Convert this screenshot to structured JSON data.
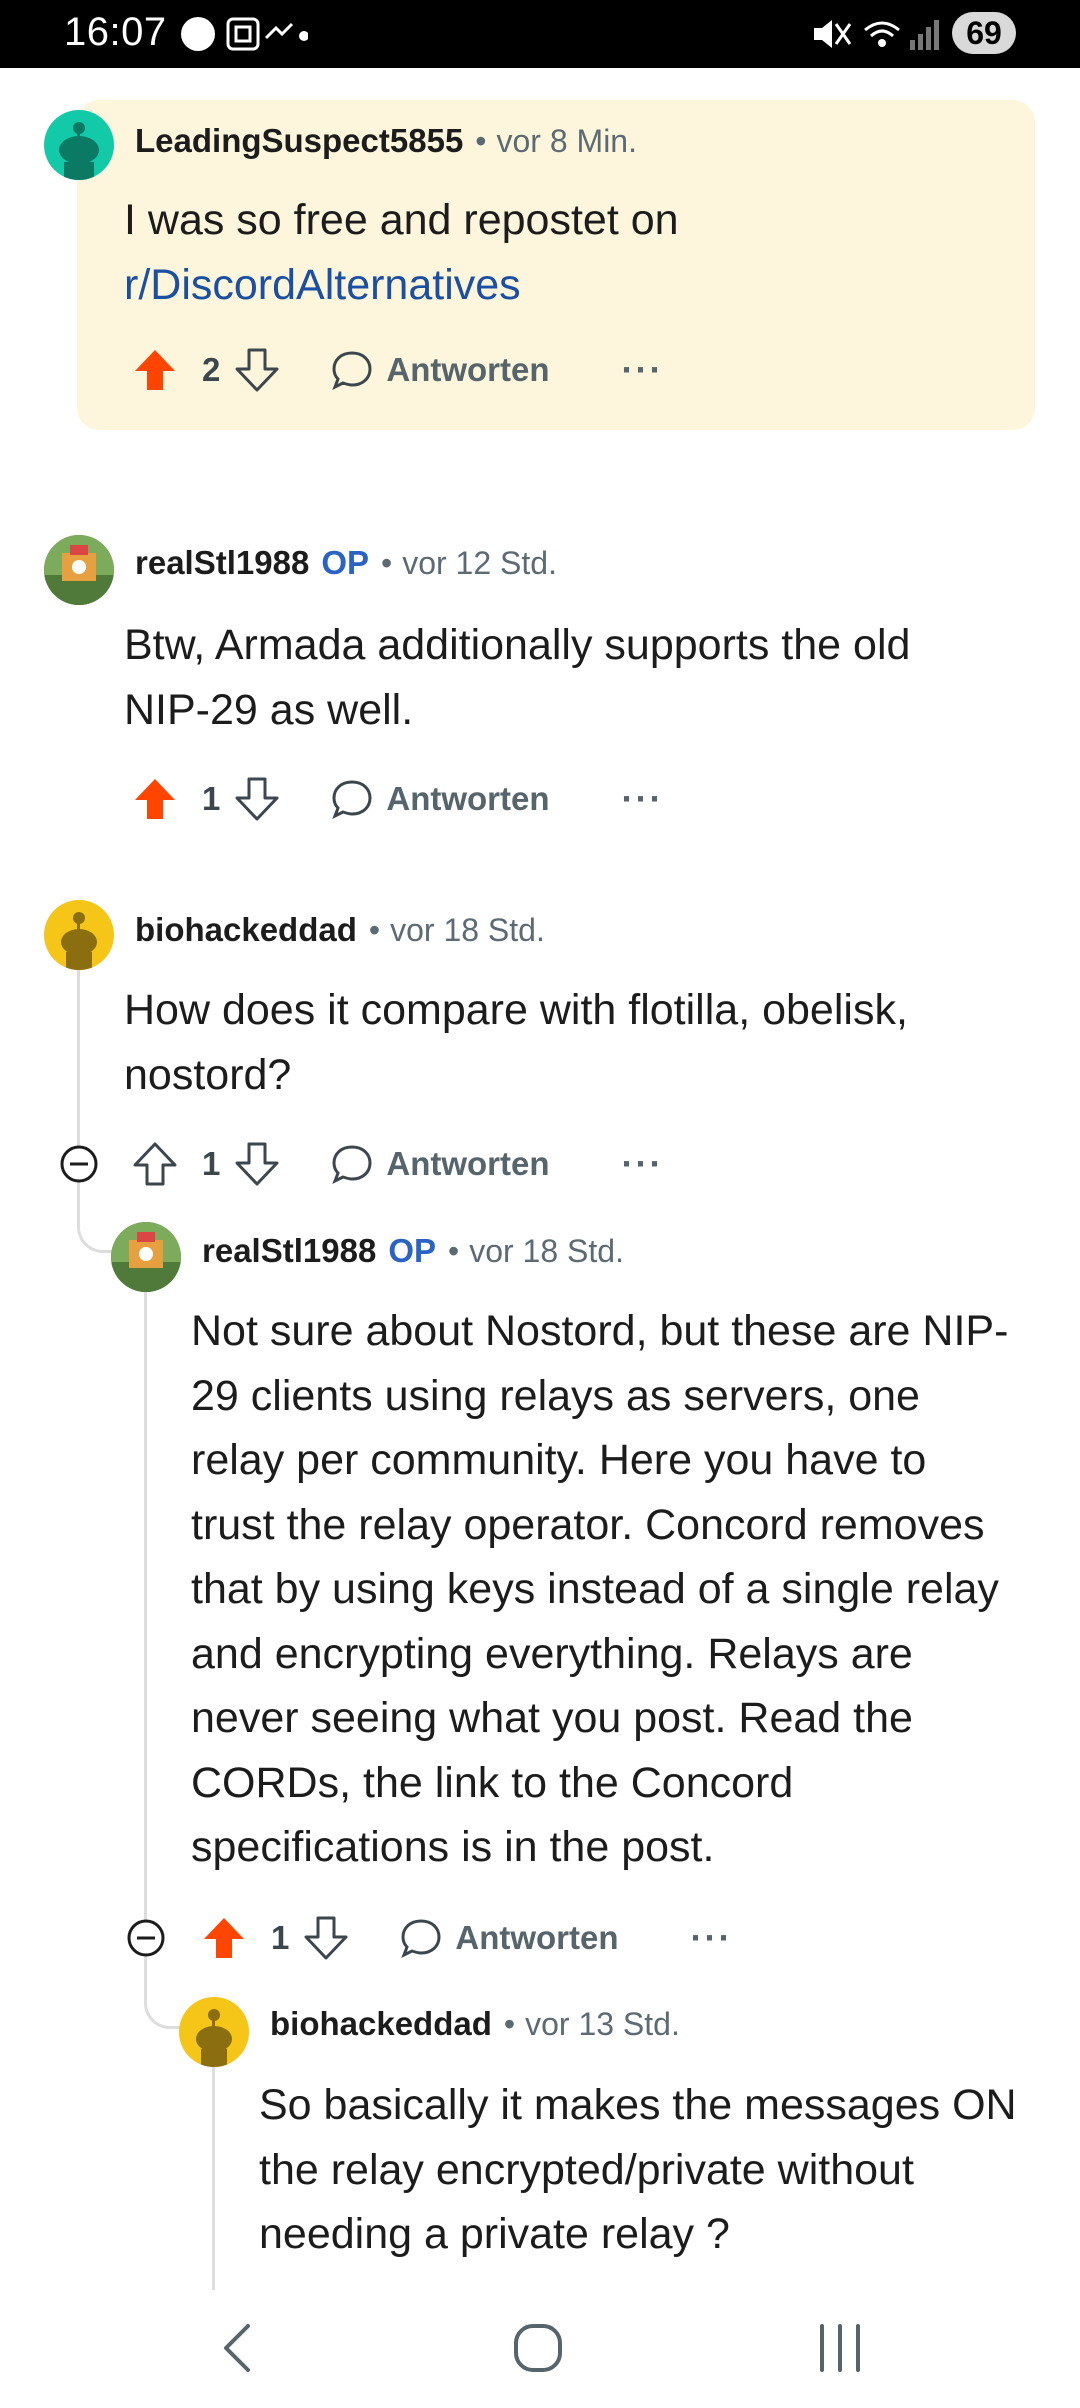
{
  "status_bar": {
    "time": "16:07",
    "battery": "69"
  },
  "comments": [
    {
      "username": "LeadingSuspect5855",
      "time": "vor 8 Min.",
      "body_line1": "I was so free and repostet on",
      "body_link": "r/DiscordAlternatives",
      "votes": "2",
      "reply_label": "Antworten",
      "more": "···"
    },
    {
      "username": "realStl1988",
      "op_badge": "OP",
      "time": "vor 12 Std.",
      "body": "Btw, Armada additionally supports the old NIP-29 as well.",
      "votes": "1",
      "reply_label": "Antworten",
      "more": "···"
    },
    {
      "username": "biohackeddad",
      "time": "vor 18 Std.",
      "body": "How does it compare with flotilla, obelisk, nostord?",
      "votes": "1",
      "reply_label": "Antworten",
      "more": "···"
    },
    {
      "username": "realStl1988",
      "op_badge": "OP",
      "time": "vor 18 Std.",
      "body": "Not sure about Nostord, but these are NIP-29 clients using relays as servers, one relay per community. Here you have to trust the relay operator. Concord removes that by using keys instead of a single relay and encrypting everything. Relays are never seeing what you post. Read the CORDs, the link to the Concord specifications is in the post.",
      "votes": "1",
      "reply_label": "Antworten",
      "more": "···"
    },
    {
      "username": "biohackeddad",
      "time": "vor 13 Std.",
      "body": "So basically it makes the messages ON the relay encrypted/private without needing a private relay ?"
    }
  ],
  "colors": {
    "upvote_active": "#ff4500",
    "op_blue": "#2a63c4",
    "highlight_bg": "#fdf6dc",
    "link": "#1b4fa3"
  },
  "icons": [
    "upvote-icon",
    "downvote-icon",
    "reply-icon",
    "collapse-icon",
    "back-icon",
    "home-icon",
    "recents-icon"
  ]
}
